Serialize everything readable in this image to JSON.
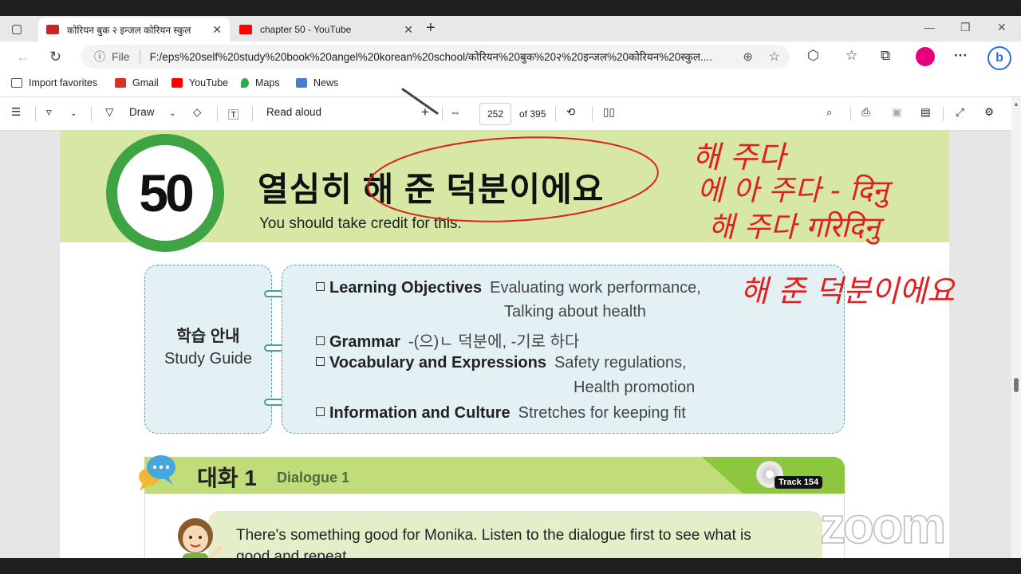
{
  "browser": {
    "tabs": [
      {
        "title": "कोरियन बुक २ इन्जल कोरियन स्कुल",
        "favicon_color": "#c62828",
        "active": true
      },
      {
        "title": "chapter 50 - YouTube",
        "favicon_color": "#ff0000",
        "active": false
      }
    ],
    "address": {
      "info_label": "File",
      "url": "F:/eps%20self%20study%20book%20angel%20korean%20school/कोरियन%20बुक%20२%20इन्जल%20कोरियन%20स्कुल...."
    },
    "bookmarks": [
      {
        "label": "Import favorites",
        "icon": "import-icon",
        "color": "#555555"
      },
      {
        "label": "Gmail",
        "icon": "gmail-icon",
        "color": "#d93025"
      },
      {
        "label": "YouTube",
        "icon": "youtube-icon",
        "color": "#ff0000"
      },
      {
        "label": "Maps",
        "icon": "maps-icon",
        "color": "#34a853"
      },
      {
        "label": "News",
        "icon": "news-icon",
        "color": "#4a7bd4"
      }
    ],
    "profile_color": "#e6007e"
  },
  "pdf_toolbar": {
    "draw_label": "Draw",
    "read_aloud_label": "Read aloud",
    "page_current": "252",
    "page_total": "of 395"
  },
  "page": {
    "lesson_number": "50",
    "lesson_title_ko": "열심히 해 준 덕분이에요",
    "lesson_title_en": "You should take credit for this.",
    "study_guide_ko": "학습 안내",
    "study_guide_en": "Study Guide",
    "objectives": [
      {
        "label": "Learning Objectives",
        "value": "Evaluating work performance,",
        "cont": "Talking about health"
      },
      {
        "label": "Grammar",
        "value": "-(으)ㄴ 덕분에, -기로 하다",
        "cont": ""
      },
      {
        "label": "Vocabulary and Expressions",
        "value": "Safety regulations,",
        "cont": "Health promotion"
      },
      {
        "label": "Information and Culture",
        "value": "Stretches for keeping fit",
        "cont": ""
      }
    ],
    "dialogue_ko": "대화 1",
    "dialogue_en": "Dialogue 1",
    "track": "Track 154",
    "instruction_line1": "There's something good for Monika. Listen to the dialogue first to see what is",
    "instruction_line2": "good and repeat."
  },
  "annotations": {
    "line1": "해 주다",
    "line2": "에 아 주다 - दिनु",
    "line3": "해 주다 गरिदिनु",
    "line4": "해 준 덕분이에요",
    "color": "#e01f1f"
  },
  "watermark": "zoom"
}
